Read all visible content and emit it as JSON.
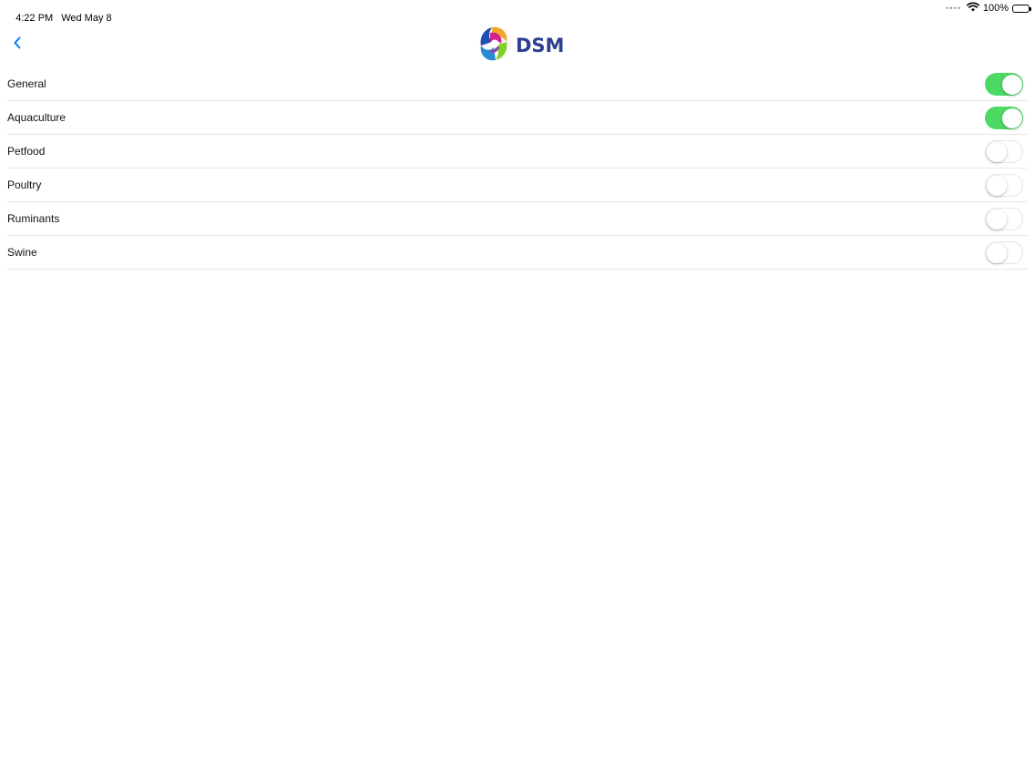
{
  "status_bar": {
    "time": "4:22 PM",
    "date": "Wed May 8",
    "battery": "100%",
    "battery_level": 1.0
  },
  "nav": {
    "back_icon": "chevron-left-icon",
    "logo_text": "DSM",
    "accent_color": "#007aff"
  },
  "settings": {
    "toggle_on_color": "#4cd964",
    "items": [
      {
        "label": "General",
        "enabled": true
      },
      {
        "label": "Aquaculture",
        "enabled": true
      },
      {
        "label": "Petfood",
        "enabled": false
      },
      {
        "label": "Poultry",
        "enabled": false
      },
      {
        "label": "Ruminants",
        "enabled": false
      },
      {
        "label": "Swine",
        "enabled": false
      }
    ]
  }
}
